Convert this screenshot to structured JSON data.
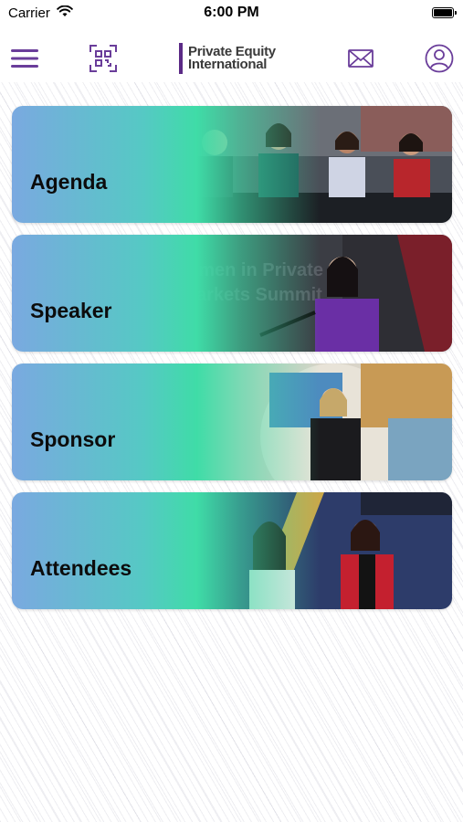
{
  "status_bar": {
    "carrier": "Carrier",
    "time": "6:00 PM"
  },
  "nav": {
    "menu_icon": "hamburger-menu-icon",
    "qr_icon": "qr-scan-icon",
    "logo_line1": "Private Equity",
    "logo_line2": "International",
    "mail_icon": "mail-icon",
    "profile_icon": "user-profile-icon",
    "accent_color": "#5b2a86"
  },
  "cards": [
    {
      "label": "Agenda"
    },
    {
      "label": "Speaker"
    },
    {
      "label": "Sponsor"
    },
    {
      "label": "Attendees"
    }
  ],
  "colors": {
    "gradient_start": "#7aa9e0",
    "gradient_end": "#3fdca7"
  }
}
